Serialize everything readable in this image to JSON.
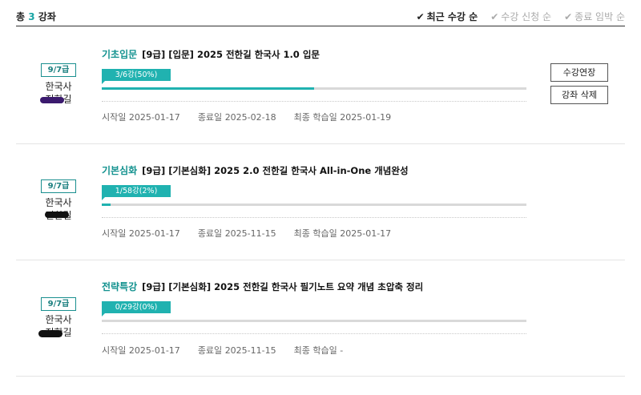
{
  "header": {
    "total_prefix": "총",
    "total_count": "3",
    "total_suffix": "강좌",
    "sort_options": [
      {
        "label": "최근 수강 순",
        "active": true
      },
      {
        "label": "수강 신청 순",
        "active": false
      },
      {
        "label": "종료 임박 순",
        "active": false
      }
    ]
  },
  "courses": [
    {
      "badge": "9/7급",
      "subject": "한국사",
      "teacher": "전한길",
      "category": "기초입문",
      "title": "[9급] [입문] 2025 전한길 한국사 1.0 입문",
      "progress_label": "3/6강(50%)",
      "progress": 0.5,
      "start_label": "시작일",
      "start": "2025-01-17",
      "end_label": "종료일",
      "end": "2025-02-18",
      "last_label": "최종 학습일",
      "last": "2025-01-19",
      "buttons": [
        "수강연장",
        "강좌 삭제"
      ]
    },
    {
      "badge": "9/7급",
      "subject": "한국사",
      "teacher": "전한길",
      "category": "기본심화",
      "title": "[9급] [기본심화] 2025 2.0 전한길 한국사 All-in-One 개념완성",
      "progress_label": "1/58강(2%)",
      "progress": 0.02,
      "start_label": "시작일",
      "start": "2025-01-17",
      "end_label": "종료일",
      "end": "2025-11-15",
      "last_label": "최종 학습일",
      "last": "2025-01-17",
      "buttons": []
    },
    {
      "badge": "9/7급",
      "subject": "한국사",
      "teacher": "전한길",
      "category": "전략특강",
      "title": "[9급] [기본심화] 2025 전한길 한국사 필기노트 요약 개념 초압축 정리",
      "progress_label": "0/29강(0%)",
      "progress": 0.0,
      "start_label": "시작일",
      "start": "2025-01-17",
      "end_label": "종료일",
      "end": "2025-11-15",
      "last_label": "최종 학습일",
      "last": "-",
      "buttons": []
    }
  ],
  "colors": {
    "accent": "#20b2b0",
    "category": "#13928f",
    "badge_border": "#1a8f8f"
  }
}
